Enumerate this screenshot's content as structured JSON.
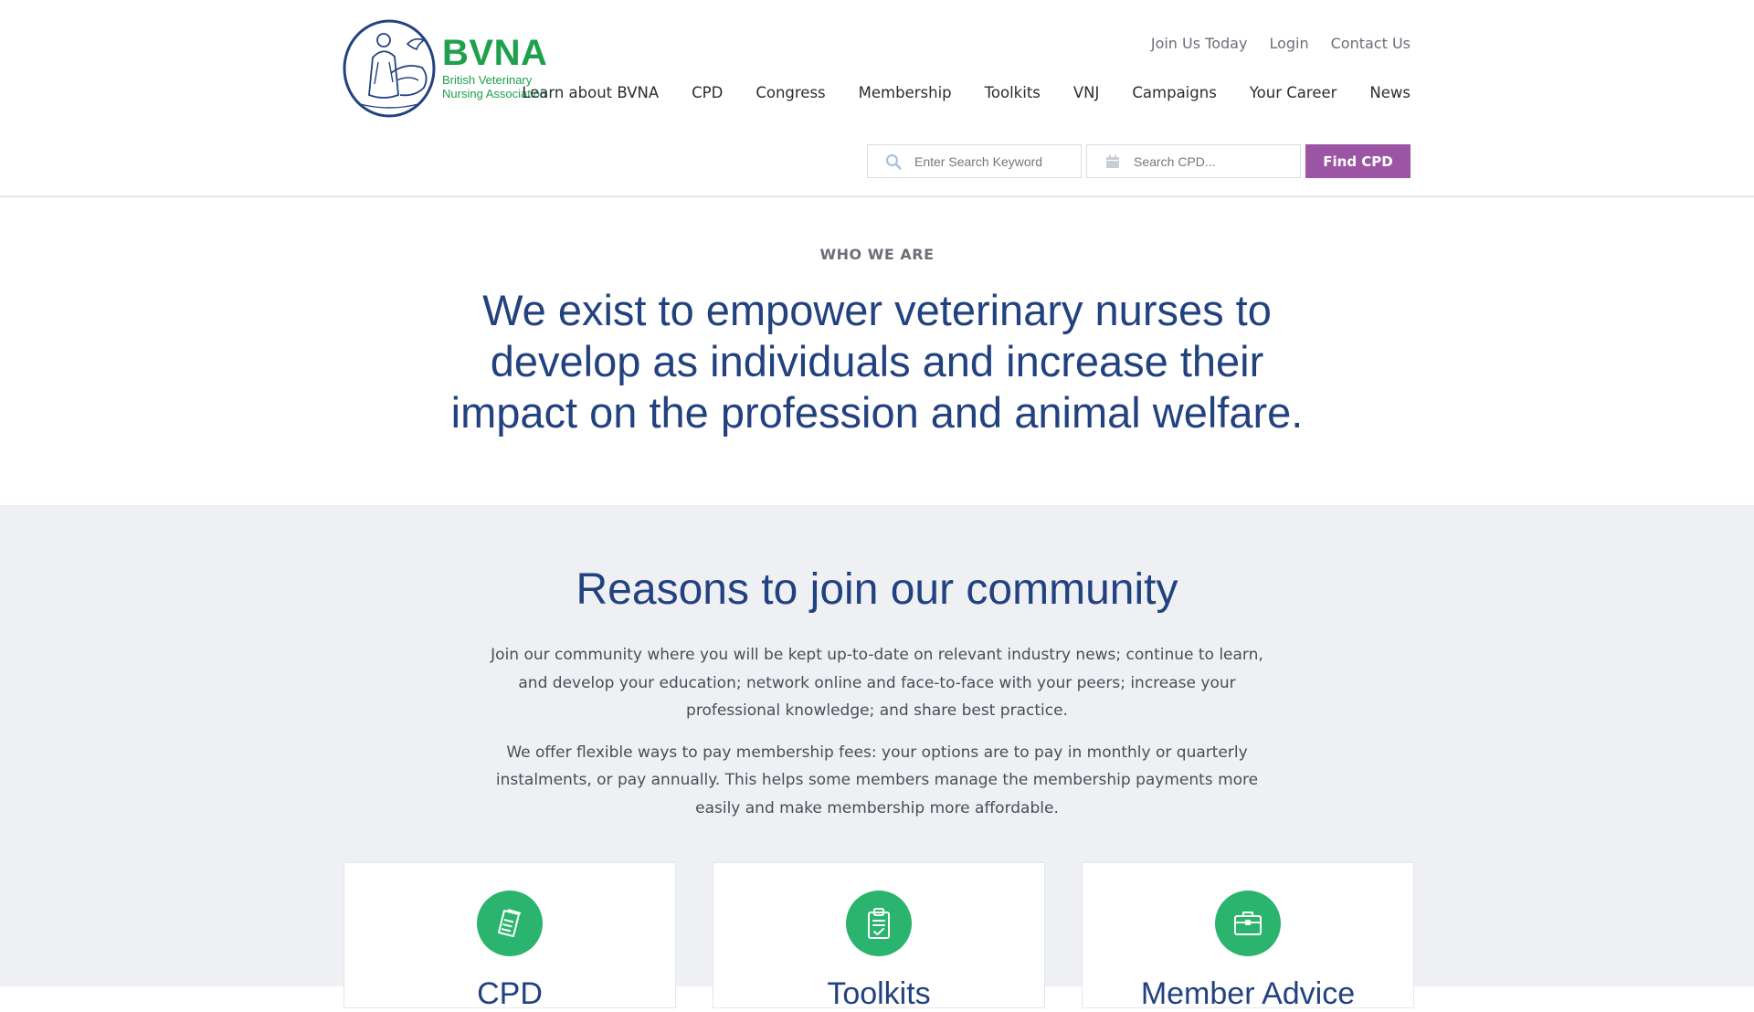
{
  "logo": {
    "abbrev": "BVNA",
    "line1": "British Veterinary",
    "line2": "Nursing Association",
    "brand_color": "#1ea04c"
  },
  "utility_nav": [
    "Join Us Today",
    "Login",
    "Contact Us"
  ],
  "main_nav": [
    "Learn about BVNA",
    "CPD",
    "Congress",
    "Membership",
    "Toolkits",
    "VNJ",
    "Campaigns",
    "Your Career",
    "News"
  ],
  "search": {
    "keyword_placeholder": "Enter Search Keyword",
    "keyword_icon": "search-icon",
    "cpd_placeholder": "Search CPD...",
    "cpd_icon": "calendar-icon",
    "button_label": "Find CPD",
    "button_color": "#9b55a4"
  },
  "who": {
    "eyebrow": "WHO WE ARE",
    "mission": "We exist to empower veterinary nurses to develop as individuals and increase their impact on the profession and animal welfare.",
    "heading_color": "#22427f"
  },
  "reasons": {
    "title": "Reasons to join our community",
    "paragraph1": "Join our community where you will be kept up-to-date on relevant industry news; continue to learn, and develop your education; network online and face-to-face with your peers; increase your professional knowledge; and share best practice.",
    "paragraph2": "We offer flexible ways to pay membership fees: your options are to pay in monthly or quarterly instalments, or pay annually. This helps some members manage the membership payments more easily and make membership more affordable.",
    "background": "#eef0f4"
  },
  "cards": [
    {
      "title": "CPD",
      "icon": "tickets-icon"
    },
    {
      "title": "Toolkits",
      "icon": "clipboard-icon"
    },
    {
      "title": "Member Advice",
      "icon": "briefcase-icon"
    }
  ],
  "accent_green": "#2ab46e"
}
